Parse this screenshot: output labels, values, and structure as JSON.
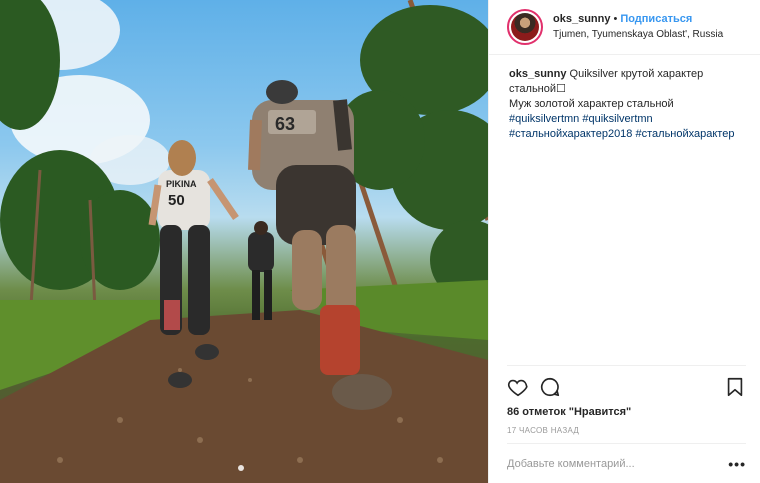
{
  "header": {
    "username": "oks_sunny",
    "separator": "•",
    "follow_label": "Подписаться",
    "location": "Tjumen, Tyumenskaya Oblast', Russia"
  },
  "caption": {
    "username": "oks_sunny",
    "line1": "Quiksilver крутой характер стальной",
    "line1_glyph": "☐",
    "line2": "Муж золотой характер стальной",
    "hashtags": [
      "#quiksilvertmn",
      "#quiksilvertmn",
      "#стальнойхарактер2018",
      "#стальнойхарактер"
    ]
  },
  "photo": {
    "bib_front": "63",
    "bib_left": "50",
    "bib_name": "PIKINA"
  },
  "actions": {
    "icons": [
      "heart-icon",
      "comment-icon",
      "bookmark-icon"
    ],
    "likes": "86 отметок \"Нравится\"",
    "time": "17 ЧАСОВ НАЗАД"
  },
  "comment": {
    "placeholder": "Добавьте комментарий...",
    "more": "•••"
  },
  "colors": {
    "follow": "#3897f0",
    "hashtag": "#003569",
    "muted": "#999999"
  }
}
